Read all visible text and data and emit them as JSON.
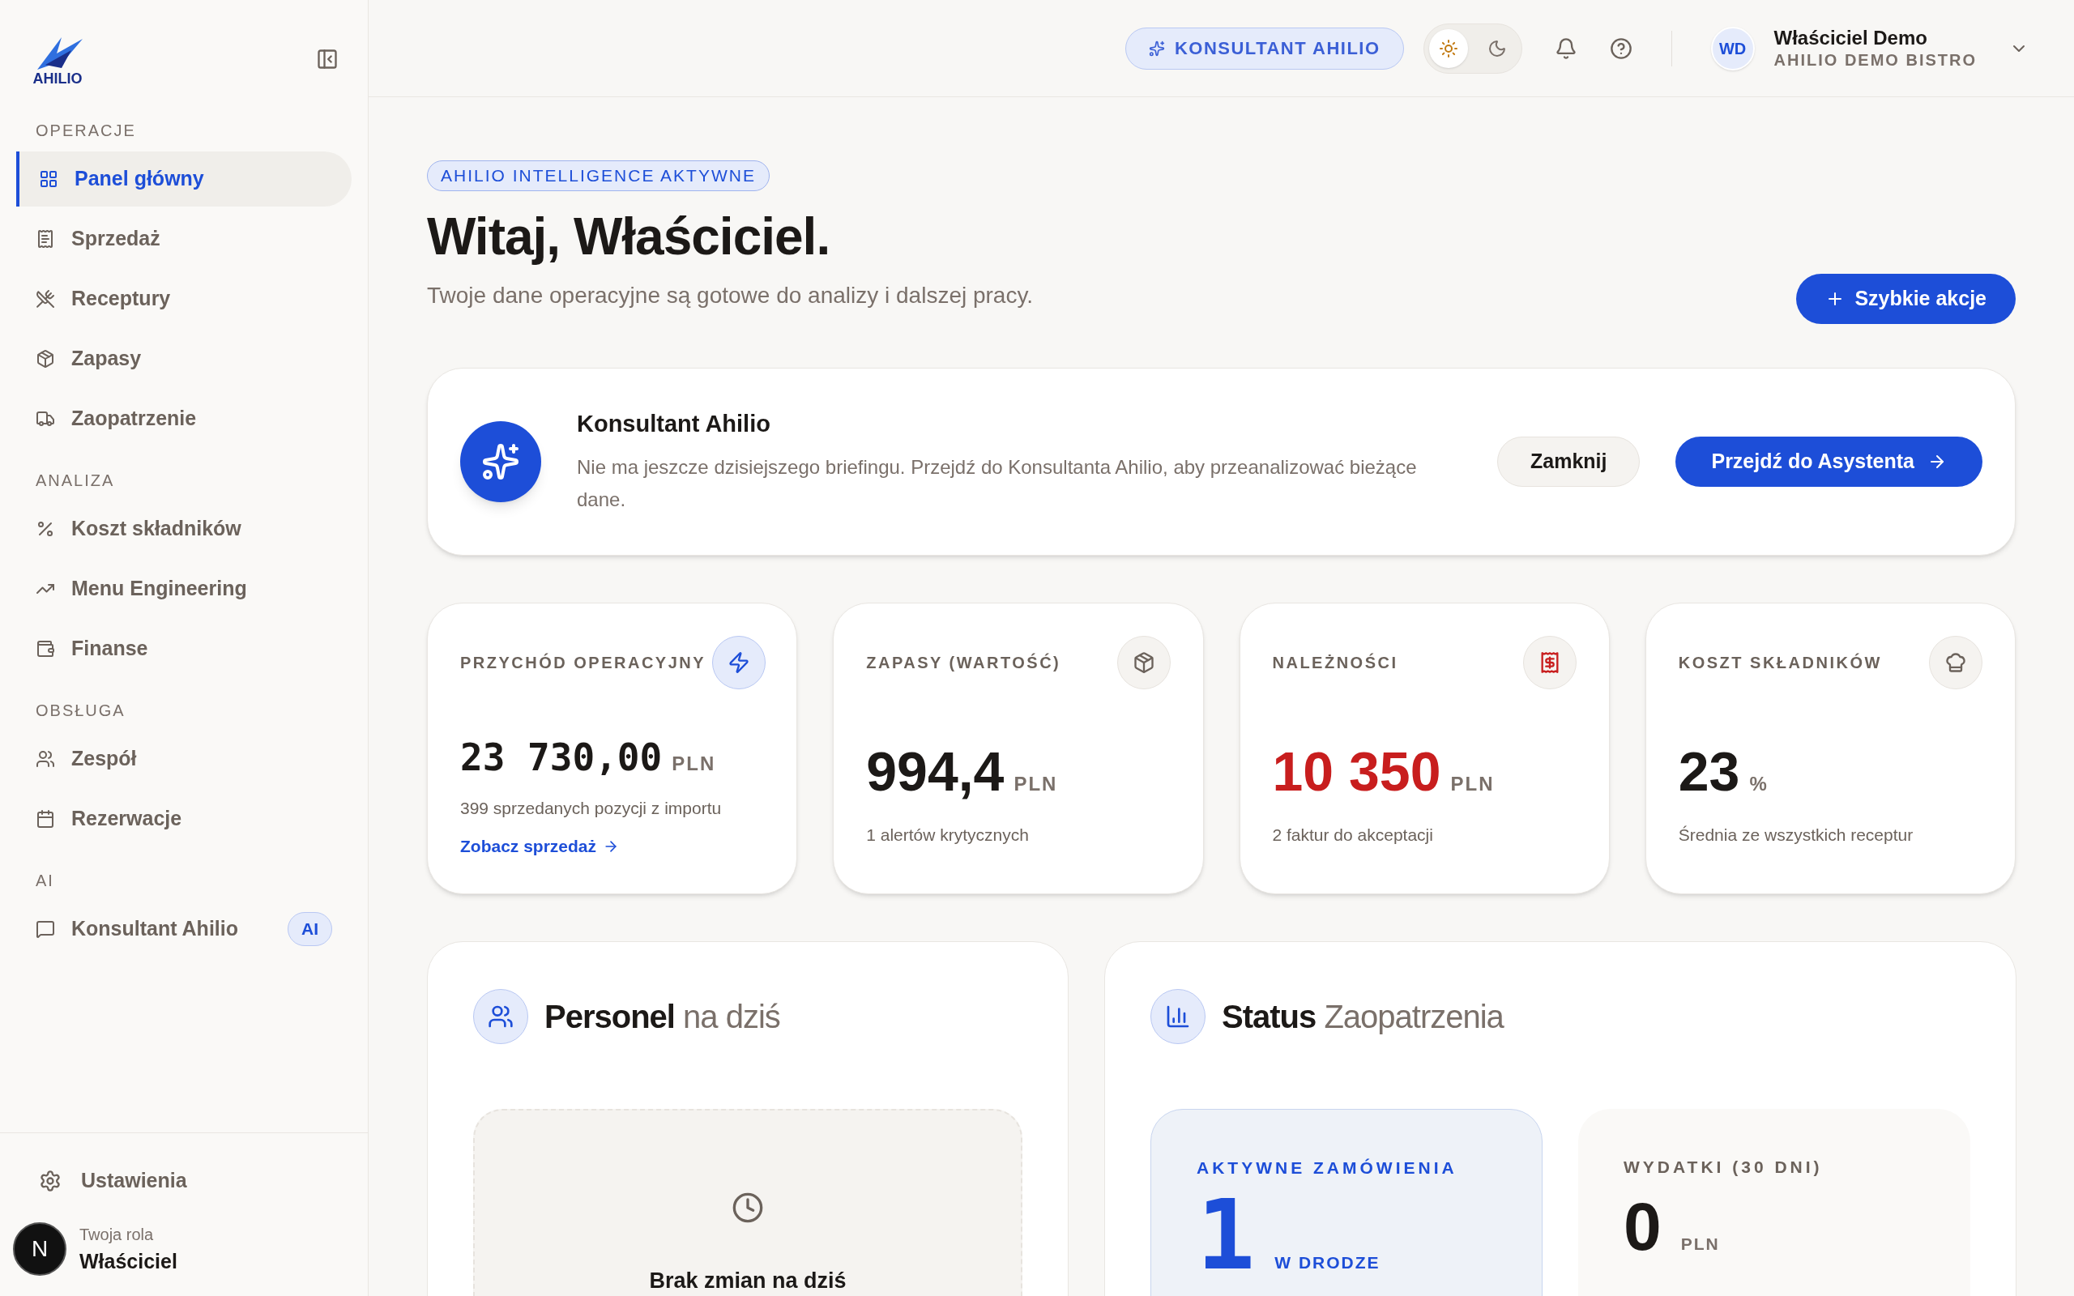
{
  "sidebar": {
    "logo": "AHILIO",
    "sections": [
      {
        "title": "OPERACJE",
        "items": [
          {
            "label": "Panel główny",
            "selected": true
          },
          {
            "label": "Sprzedaż",
            "selected": false
          },
          {
            "label": "Receptury",
            "selected": false
          },
          {
            "label": "Zapasy",
            "selected": false
          },
          {
            "label": "Zaopatrzenie",
            "selected": false
          }
        ]
      },
      {
        "title": "ANALIZA",
        "items": [
          {
            "label": "Koszt składników",
            "selected": false
          },
          {
            "label": "Menu Engineering",
            "selected": false
          },
          {
            "label": "Finanse",
            "selected": false
          }
        ]
      },
      {
        "title": "OBSŁUGA",
        "items": [
          {
            "label": "Zespół",
            "selected": false
          },
          {
            "label": "Rezerwacje",
            "selected": false
          }
        ]
      },
      {
        "title": "AI",
        "items": [
          {
            "label": "Konsultant Ahilio",
            "selected": false,
            "badge": "AI"
          }
        ]
      }
    ],
    "settings": "Ustawienia",
    "role_label": "Twoja rola",
    "role": "Właściciel",
    "dev_badge": "N"
  },
  "header": {
    "consultant_button": "KONSULTANT AHILIO",
    "dark_mode": false,
    "user": {
      "initials": "WD",
      "name": "Właściciel Demo",
      "company": "AHILIO DEMO BISTRO"
    }
  },
  "hero": {
    "badge": "AHILIO INTELLIGENCE AKTYWNE",
    "title": "Witaj, Właściciel.",
    "subtitle": "Twoje dane operacyjne są gotowe do analizy i dalszej pracy.",
    "action": "Szybkie akcje"
  },
  "briefing": {
    "title": "Konsultant Ahilio",
    "text": "Nie ma jeszcze dzisiejszego briefingu. Przejdź do Konsultanta Ahilio, aby przeanalizować bieżące dane.",
    "dismiss": "Zamknij",
    "primary": "Przejdź do Asystenta"
  },
  "stats": [
    {
      "label": "PRZYCHÓD OPERACYJNY",
      "value": "23 730,00",
      "unit": "PLN",
      "note": "399 sprzedanych pozycji z importu",
      "link": "Zobacz sprzedaż",
      "highlighted": true,
      "alert": false
    },
    {
      "label": "ZAPASY (WARTOŚĆ)",
      "value": "994,4",
      "unit": "PLN",
      "note": "1 alertów krytycznych",
      "highlighted": false,
      "alert": false
    },
    {
      "label": "NALEŻNOŚCI",
      "value": "10 350",
      "unit": "PLN",
      "note": "2 faktur do akceptacji",
      "highlighted": false,
      "alert": true
    },
    {
      "label": "KOSZT SKŁADNIKÓW",
      "value": "23",
      "unit": "%",
      "note": "Średnia ze wszystkich receptur",
      "highlighted": false,
      "alert": false
    }
  ],
  "staff": {
    "title_bold": "Personel",
    "title_rest": "na dziś",
    "empty": "Brak zmian na dziś"
  },
  "supply": {
    "title_bold": "Status",
    "title_rest": "Zaopatrzenia",
    "tiles": [
      {
        "label": "AKTYWNE ZAMÓWIENIA",
        "value": "1",
        "unit": "W DRODZE",
        "highlight": true
      },
      {
        "label": "WYDATKI (30 DNI)",
        "value": "0",
        "unit": "PLN",
        "highlight": false
      }
    ]
  }
}
